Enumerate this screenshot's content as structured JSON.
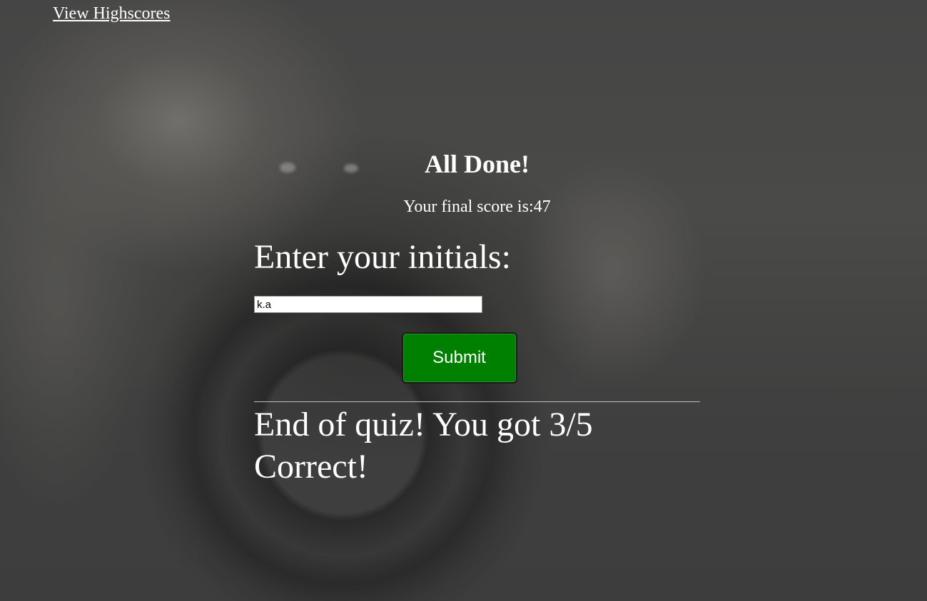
{
  "nav": {
    "highscores_link": "View Highscores"
  },
  "summary": {
    "title": "All Done!",
    "score_text": "Your final score is:47",
    "initials_label": "Enter your initials:",
    "initials_value": "k.a",
    "submit_label": "Submit",
    "result_text": "End of quiz! You got 3/5 Correct!"
  },
  "colors": {
    "submit_background": "#008000",
    "text": "#ffffff",
    "page_background": "#424242"
  }
}
